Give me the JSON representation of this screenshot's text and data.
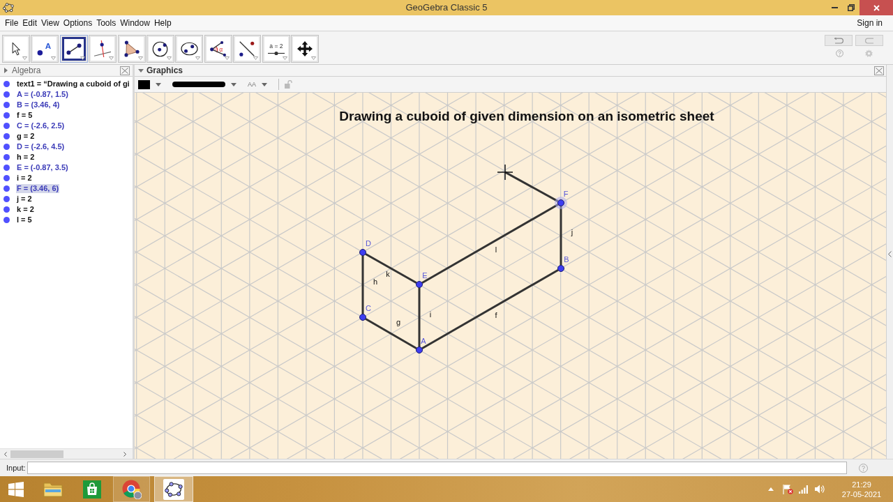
{
  "window": {
    "title": "GeoGebra Classic 5"
  },
  "menu": [
    "File",
    "Edit",
    "View",
    "Options",
    "Tools",
    "Window",
    "Help"
  ],
  "sign_in": "Sign in",
  "tools": [
    {
      "selected": false
    },
    {
      "selected": false,
      "label": "A"
    },
    {
      "selected": true
    },
    {
      "selected": false
    },
    {
      "selected": false
    },
    {
      "selected": false
    },
    {
      "selected": false
    },
    {
      "selected": false,
      "label": "α"
    },
    {
      "selected": false
    },
    {
      "selected": false,
      "label": "a = 2"
    },
    {
      "selected": false
    }
  ],
  "algebra": {
    "title": "Algebra",
    "focused": false,
    "style_bar_expanded": false,
    "items": [
      {
        "kind": "text",
        "text": "text1 = “Drawing a cuboid of gi",
        "visible": true,
        "selected": false
      },
      {
        "kind": "point",
        "text": "A = (-0.87, 1.5)",
        "visible": true,
        "selected": false
      },
      {
        "kind": "point",
        "text": "B = (3.46, 4)",
        "visible": true,
        "selected": false
      },
      {
        "kind": "segment",
        "text": "f = 5",
        "visible": true,
        "selected": false
      },
      {
        "kind": "point",
        "text": "C = (-2.6, 2.5)",
        "visible": true,
        "selected": false
      },
      {
        "kind": "segment",
        "text": "g = 2",
        "visible": true,
        "selected": false
      },
      {
        "kind": "point",
        "text": "D = (-2.6, 4.5)",
        "visible": true,
        "selected": false
      },
      {
        "kind": "segment",
        "text": "h = 2",
        "visible": true,
        "selected": false
      },
      {
        "kind": "point",
        "text": "E = (-0.87, 3.5)",
        "visible": true,
        "selected": false
      },
      {
        "kind": "segment",
        "text": "i = 2",
        "visible": true,
        "selected": false
      },
      {
        "kind": "point",
        "text": "F = (3.46, 6)",
        "visible": true,
        "selected": true
      },
      {
        "kind": "segment",
        "text": "j = 2",
        "visible": true,
        "selected": false
      },
      {
        "kind": "segment",
        "text": "k = 2",
        "visible": true,
        "selected": false
      },
      {
        "kind": "segment",
        "text": "l = 5",
        "visible": true,
        "selected": false
      }
    ]
  },
  "graphics": {
    "title": "Graphics",
    "focused": true,
    "style_bar_expanded": true,
    "style_bar": {
      "font_size_label": "AA"
    },
    "heading": "Drawing a cuboid of given dimension on an isometric sheet",
    "points": [
      {
        "label": "A",
        "selected": false
      },
      {
        "label": "B",
        "selected": false
      },
      {
        "label": "C",
        "selected": false
      },
      {
        "label": "D",
        "selected": false
      },
      {
        "label": "E",
        "selected": false
      },
      {
        "label": "F",
        "selected": true
      }
    ],
    "segments": [
      {
        "label": "f"
      },
      {
        "label": "g"
      },
      {
        "label": "h"
      },
      {
        "label": "i"
      },
      {
        "label": "j"
      },
      {
        "label": "k"
      },
      {
        "label": "l"
      }
    ],
    "preview_segment": true
  },
  "input_bar": {
    "label": "Input:"
  },
  "taskbar": {
    "apps": [
      {
        "running": false,
        "selected": false
      },
      {
        "running": false,
        "selected": false
      },
      {
        "running": true,
        "selected": false
      },
      {
        "running": true,
        "selected": true
      }
    ],
    "clock": {
      "time": "21:29",
      "date": "27-05-2021"
    }
  }
}
